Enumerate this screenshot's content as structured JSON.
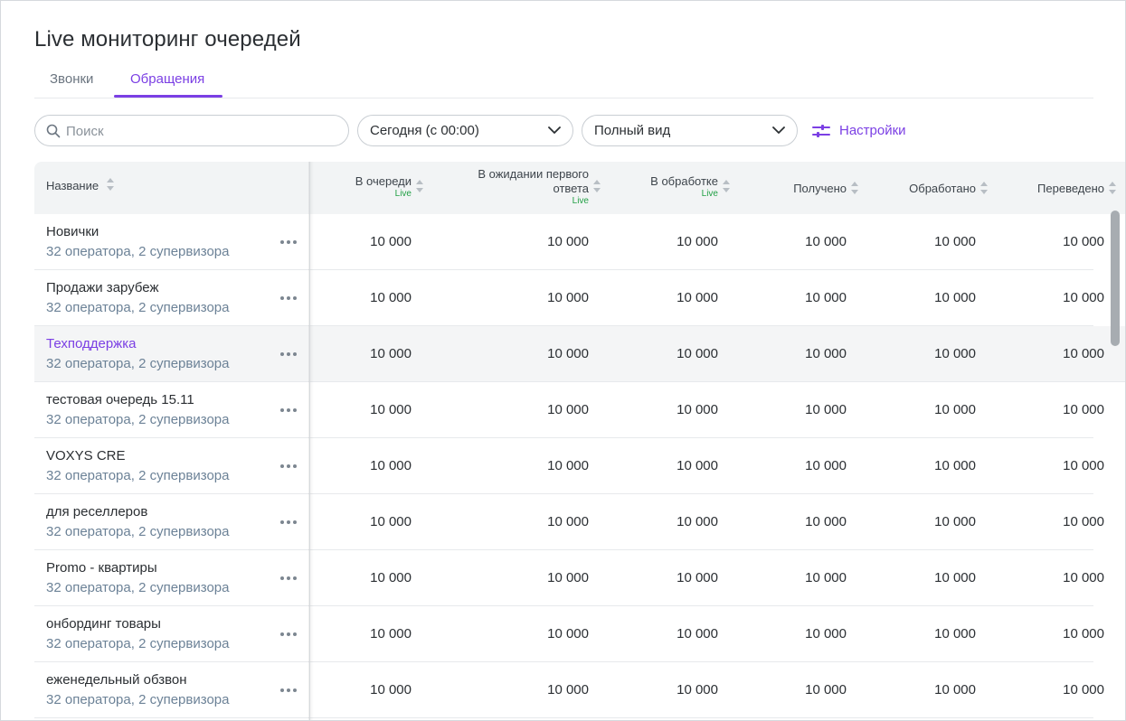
{
  "page": {
    "title": "Live мониторинг очередей"
  },
  "tabs": [
    {
      "label": "Звонки",
      "active": false
    },
    {
      "label": "Обращения",
      "active": true
    }
  ],
  "filters": {
    "search_placeholder": "Поиск",
    "period": "Сегодня (с 00:00)",
    "view": "Полный вид",
    "settings_label": "Настройки"
  },
  "colors": {
    "accent": "#7b3fe4",
    "live": "#23a046",
    "subtext": "#6c8297"
  },
  "table": {
    "columns": [
      {
        "label": "Название",
        "live": ""
      },
      {
        "label": "В очереди",
        "live": "Live"
      },
      {
        "label": "В ожидании первого ответа",
        "live": "Live"
      },
      {
        "label": "В обработке",
        "live": "Live"
      },
      {
        "label": "Получено",
        "live": ""
      },
      {
        "label": "Обработано",
        "live": ""
      },
      {
        "label": "Переведено",
        "live": ""
      }
    ],
    "rows": [
      {
        "name": "Новички",
        "sub": "32 оператора, 2 супервизора",
        "values": [
          "10 000",
          "10 000",
          "10 000",
          "10 000",
          "10 000",
          "10 000"
        ],
        "highlighted": false
      },
      {
        "name": "Продажи зарубеж",
        "sub": "32 оператора, 2 супервизора",
        "values": [
          "10 000",
          "10 000",
          "10 000",
          "10 000",
          "10 000",
          "10 000"
        ],
        "highlighted": false
      },
      {
        "name": "Техподдержка",
        "sub": "32 оператора, 2 супервизора",
        "values": [
          "10 000",
          "10 000",
          "10 000",
          "10 000",
          "10 000",
          "10 000"
        ],
        "highlighted": true
      },
      {
        "name": "тестовая очередь 15.11",
        "sub": "32 оператора, 2 супервизора",
        "values": [
          "10 000",
          "10 000",
          "10 000",
          "10 000",
          "10 000",
          "10 000"
        ],
        "highlighted": false
      },
      {
        "name": "VOXYS CRE",
        "sub": "32 оператора, 2 супервизора",
        "values": [
          "10 000",
          "10 000",
          "10 000",
          "10 000",
          "10 000",
          "10 000"
        ],
        "highlighted": false
      },
      {
        "name": "для реселлеров",
        "sub": "32 оператора, 2 супервизора",
        "values": [
          "10 000",
          "10 000",
          "10 000",
          "10 000",
          "10 000",
          "10 000"
        ],
        "highlighted": false
      },
      {
        "name": "Promo - квартиры",
        "sub": "32 оператора, 2 супервизора",
        "values": [
          "10 000",
          "10 000",
          "10 000",
          "10 000",
          "10 000",
          "10 000"
        ],
        "highlighted": false
      },
      {
        "name": "онбординг товары",
        "sub": "32 оператора, 2 супервизора",
        "values": [
          "10 000",
          "10 000",
          "10 000",
          "10 000",
          "10 000",
          "10 000"
        ],
        "highlighted": false
      },
      {
        "name": "еженедельный обзвон",
        "sub": "32 оператора, 2 супервизора",
        "values": [
          "10 000",
          "10 000",
          "10 000",
          "10 000",
          "10 000",
          "10 000"
        ],
        "highlighted": false
      }
    ]
  },
  "icons": {
    "search": "search-icon",
    "chevron": "chevron-down-icon",
    "settings": "sliders-icon",
    "more": "more-dots-icon"
  }
}
